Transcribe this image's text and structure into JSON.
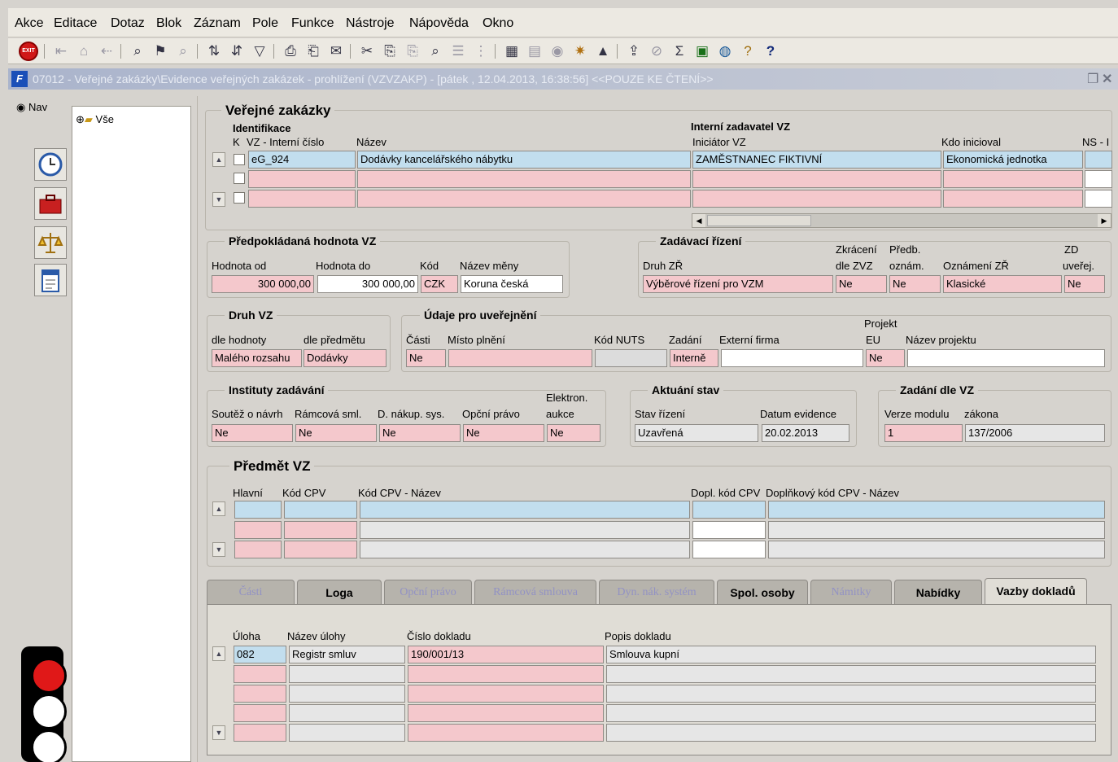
{
  "menu": [
    "Akce",
    "Editace",
    "Dotaz",
    "Blok",
    "Záznam",
    "Pole",
    "Funkce",
    "Nástroje",
    "Nápověda",
    "Okno"
  ],
  "window_title": "07012 - Veřejné zakázky\\Evidence veřejných zakázek - prohlížení (VZVZAKP) - [pátek , 12.04.2013, 16:38:56] <<POUZE KE ČTENÍ>>",
  "nav": {
    "label": "Nav",
    "tree_root": "Vše"
  },
  "vz": {
    "title": "Veřejné zakázky",
    "hdr_ident": "Identifikace",
    "hdr_zadavatel": "Interní zadavatel VZ",
    "col_k": "K",
    "col_id": "VZ - Interní číslo",
    "col_nazev": "Název",
    "col_iniciator": "Iniciátor VZ",
    "col_kdo": "Kdo inicioval",
    "col_ns": "NS - I",
    "rows": [
      {
        "id": "eG_924",
        "nazev": "Dodávky kancelářského nábytku",
        "iniciator": "ZAMĚSTNANEC FIKTIVNÍ",
        "kdo": "Ekonomická jednotka"
      }
    ]
  },
  "hodnota": {
    "title": "Předpokládaná hodnota VZ",
    "lbl_od": "Hodnota od",
    "lbl_do": "Hodnota do",
    "lbl_kod": "Kód",
    "lbl_mena": "Název měny",
    "od": "300 000,00",
    "do": "300 000,00",
    "kod": "CZK",
    "mena": "Koruna česká"
  },
  "rizeni": {
    "title": "Zadávací řízení",
    "lbl_druh": "Druh ZŘ",
    "lbl_zkr1": "Zkrácení",
    "lbl_zkr2": "dle ZVZ",
    "lbl_pr1": "Předb.",
    "lbl_pr2": "oznám.",
    "lbl_ozn": "Oznámení ZŘ",
    "lbl_zd1": "ZD",
    "lbl_zd2": "uveřej.",
    "druh": "Výběrové řízení pro VZM",
    "zkr": "Ne",
    "pr": "Ne",
    "ozn": "Klasické",
    "zd": "Ne"
  },
  "druh": {
    "title": "Druh VZ",
    "lbl_hod": "dle hodnoty",
    "lbl_pred": "dle předmětu",
    "hod": "Malého rozsahu",
    "pred": "Dodávky"
  },
  "udaje": {
    "title": "Údaje pro uveřejnění",
    "lbl_casti": "Části",
    "lbl_misto": "Místo plnění",
    "lbl_nuts": "Kód NUTS",
    "lbl_zad": "Zadání",
    "lbl_firma": "Externí firma",
    "lbl_proj1": "Projekt",
    "lbl_proj2": "EU",
    "lbl_nproj": "Název projektu",
    "casti": "Ne",
    "zad": "Interně",
    "eu": "Ne"
  },
  "instituty": {
    "title": "Instituty zadávání",
    "lbl_sout": "Soutěž o návrh",
    "lbl_ram": "Rámcová sml.",
    "lbl_dnak": "D. nákup. sys.",
    "lbl_opc": "Opční právo",
    "lbl_el1": "Elektron.",
    "lbl_el2": "aukce",
    "sout": "Ne",
    "ram": "Ne",
    "dnak": "Ne",
    "opc": "Ne",
    "el": "Ne"
  },
  "stav": {
    "title": "Aktuání stav",
    "lbl_stav": "Stav řízení",
    "lbl_datum": "Datum evidence",
    "stav": "Uzavřená",
    "datum": "20.02.2013"
  },
  "zadani": {
    "title": "Zadání dle VZ",
    "lbl_verze": "Verze modulu",
    "lbl_zakon": "zákona",
    "verze": "1",
    "zakon": "137/2006"
  },
  "predmet": {
    "title": "Předmět VZ",
    "lbl_hlavni": "Hlavní",
    "lbl_cpv": "Kód CPV",
    "lbl_cpvnazev": "Kód CPV - Název",
    "lbl_dopl": "Dopl. kód CPV",
    "lbl_doplnazev": "Doplňkový kód CPV - Název"
  },
  "tabs": [
    "Části",
    "Loga",
    "Opční právo",
    "Rámcová smlouva",
    "Dyn. nák. systém",
    "Spol. osoby",
    "Námitky",
    "Nabídky",
    "Vazby dokladů"
  ],
  "doklady": {
    "lbl_uloha": "Úloha",
    "lbl_nazev": "Název úlohy",
    "lbl_cislo": "Číslo dokladu",
    "lbl_popis": "Popis dokladu",
    "rows": [
      {
        "uloha": "082",
        "nazev": "Registr smluv",
        "cislo": "190/001/13",
        "popis": "Smlouva kupní"
      }
    ]
  },
  "icons": [
    "exit-icon",
    "first-record-icon",
    "save-icon",
    "previous-icon",
    "enter-query-icon",
    "execute-query-icon",
    "cancel-query-icon",
    "sort-asc-icon",
    "sort-desc-icon",
    "filter-icon",
    "print-icon",
    "print-setup-icon",
    "email-icon",
    "cut-icon",
    "copy-icon",
    "paste-icon",
    "find-icon",
    "list-icon",
    "tree-icon",
    "calculator-icon",
    "document-icon",
    "globe-icon",
    "settings-icon",
    "warning-icon",
    "export-icon",
    "attach-icon",
    "sum-icon",
    "excel-icon",
    "chart-icon",
    "help-icon",
    "context-help-icon"
  ],
  "colors": {
    "required": "#f4c8cc",
    "current": "#c2deee",
    "background": "#d6d3ce"
  }
}
